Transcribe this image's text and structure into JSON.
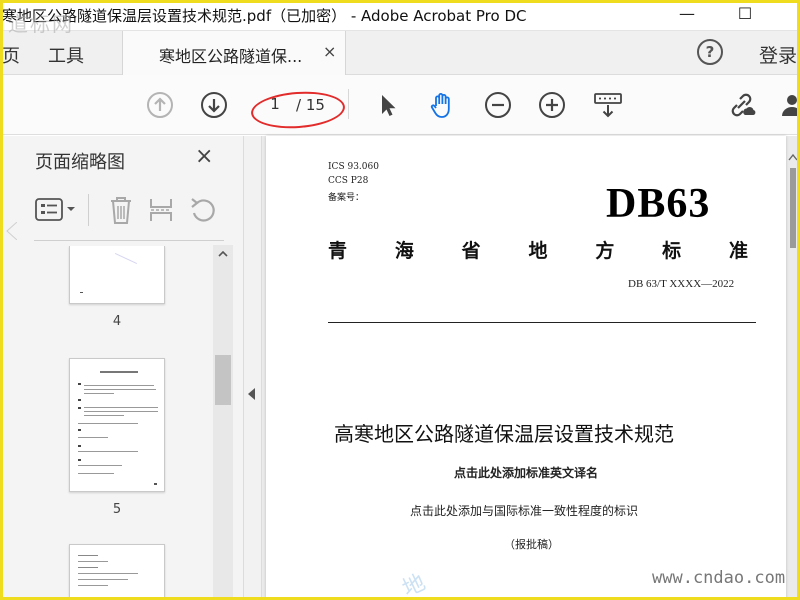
{
  "window": {
    "title": "寒地区公路隧道保温层设置技术规范.pdf（已加密） - Adobe Acrobat Pro DC",
    "minimize_glyph": "—",
    "maximize_glyph": "☐",
    "watermark_top": "道标网"
  },
  "tabs": {
    "home_partial": "页",
    "tools": "工具",
    "document": "寒地区公路隧道保...",
    "close_glyph": "×",
    "help_glyph": "?",
    "login": "登录"
  },
  "toolbar": {
    "current_page": "1",
    "total_pages": "/ 15",
    "icons": [
      "prev-page-icon",
      "next-page-icon",
      "select-cursor-icon",
      "hand-tool-icon",
      "zoom-out-icon",
      "zoom-in-icon",
      "keyboard-scroll-icon",
      "share-link-icon",
      "account-icon"
    ],
    "hand_color": "#1473e6",
    "annotation_color": "#e22b2b"
  },
  "thumbnails_pane": {
    "title": "页面缩略图",
    "close_glyph": "×",
    "pages": [
      {
        "label": "4"
      },
      {
        "label": "5"
      },
      {
        "label": ""
      }
    ]
  },
  "document": {
    "ics": "ICS 93.060",
    "ccs": "CCS P28",
    "record": "备案号：",
    "code": "DB63",
    "province": [
      "青",
      "海",
      "省",
      "地",
      "方",
      "标",
      "准"
    ],
    "standard_number": "DB 63/T XXXX—2022",
    "title": "高寒地区公路隧道保温层设置技术规范",
    "english_placeholder": "点击此处添加标准英文译名",
    "consistency_placeholder": "点击此处添加与国际标准一致性程度的标识",
    "stage": "（报批稿）"
  },
  "footer": {
    "watermark_url": "www.cndao.com",
    "watermark_logo": "地"
  }
}
